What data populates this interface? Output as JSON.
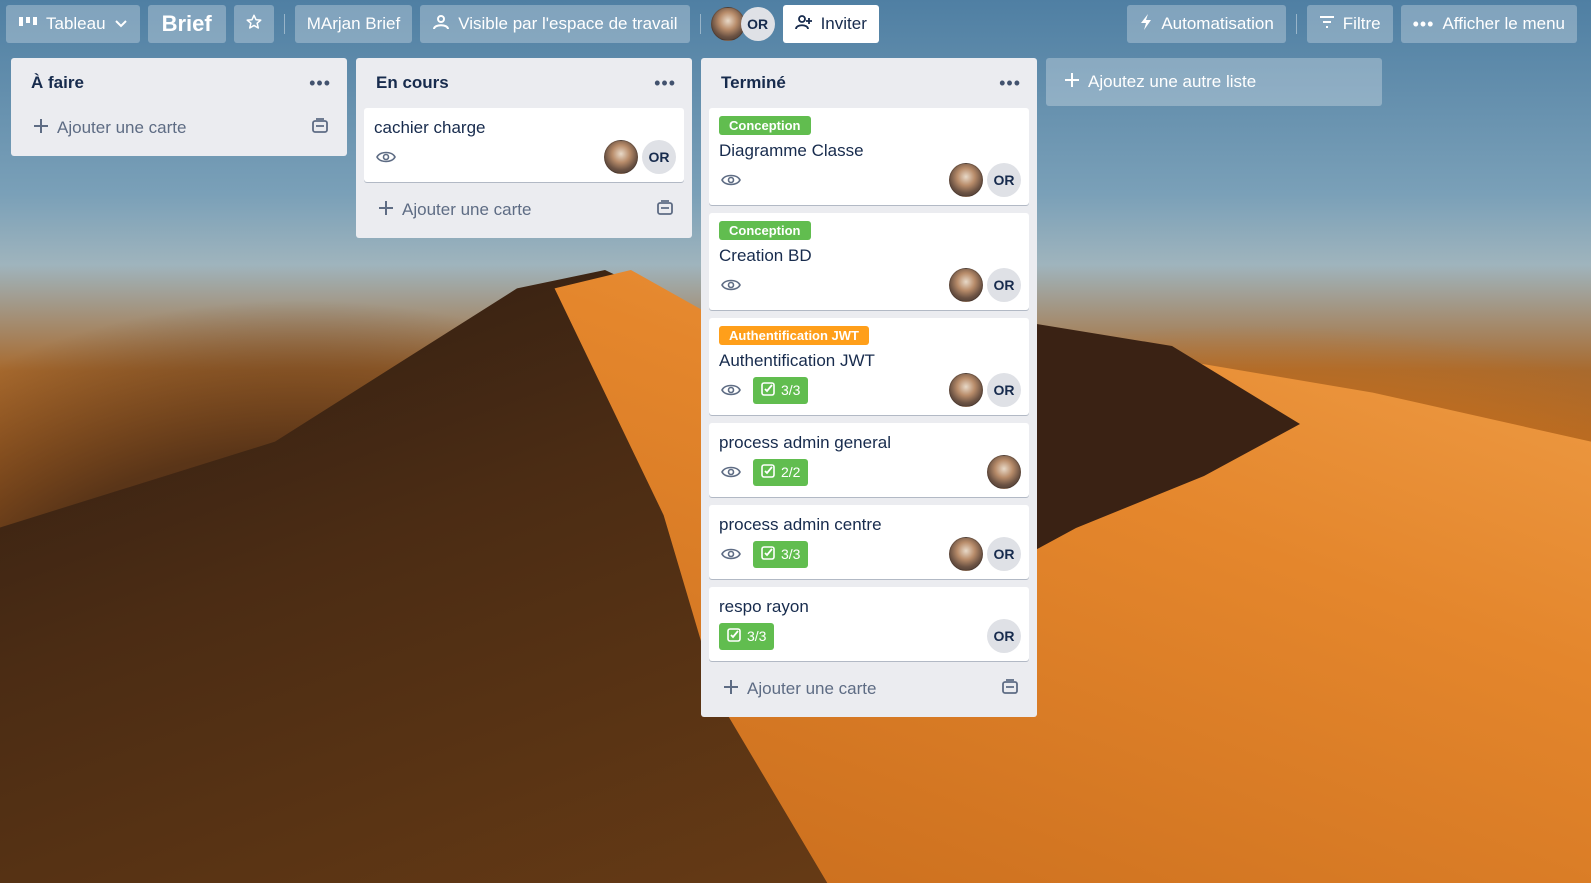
{
  "header": {
    "view_label": "Tableau",
    "board_title": "Brief",
    "workspace": "MArjan Brief",
    "visibility": "Visible par l'espace de travail",
    "member_initials": "OR",
    "invite": "Inviter",
    "automation": "Automatisation",
    "filter": "Filtre",
    "show_menu": "Afficher le menu"
  },
  "lists": [
    {
      "title": "À faire",
      "add_card": "Ajouter une carte",
      "cards": []
    },
    {
      "title": "En cours",
      "add_card": "Ajouter une carte",
      "cards": [
        {
          "title": "cachier charge",
          "watch": true,
          "members": [
            "photo",
            "OR"
          ]
        }
      ]
    },
    {
      "title": "Terminé",
      "add_card": "Ajouter une carte",
      "cards": [
        {
          "label": "Conception",
          "label_color": "#61bd4f",
          "title": "Diagramme Classe",
          "watch": true,
          "members": [
            "photo",
            "OR"
          ]
        },
        {
          "label": "Conception",
          "label_color": "#61bd4f",
          "title": "Creation BD",
          "watch": true,
          "members": [
            "photo",
            "OR"
          ]
        },
        {
          "label": "Authentification JWT",
          "label_color": "#ff9f1a",
          "title": "Authentification JWT",
          "watch": true,
          "checklist": "3/3",
          "members": [
            "photo",
            "OR"
          ]
        },
        {
          "title": "process admin general",
          "watch": true,
          "checklist": "2/2",
          "members": [
            "photo"
          ]
        },
        {
          "title": "process admin centre",
          "watch": true,
          "checklist": "3/3",
          "members": [
            "photo",
            "OR"
          ]
        },
        {
          "title": "respo rayon",
          "watch": false,
          "checklist": "3/3",
          "members": [
            "OR"
          ]
        }
      ]
    }
  ],
  "add_list": "Ajoutez une autre liste",
  "colors": {
    "label_green": "#61bd4f",
    "label_orange": "#ff9f1a",
    "list_bg": "#ebecf0",
    "text": "#172b4d"
  },
  "icons": {
    "view": "board-icon",
    "star": "star-icon",
    "visibility": "workspace-icon",
    "invite": "add-member-icon",
    "automation": "lightning-icon",
    "filter": "filter-icon",
    "menu": "more-icon",
    "watch": "eye-icon",
    "checklist": "checklist-icon",
    "template": "template-icon",
    "add": "plus-icon"
  }
}
